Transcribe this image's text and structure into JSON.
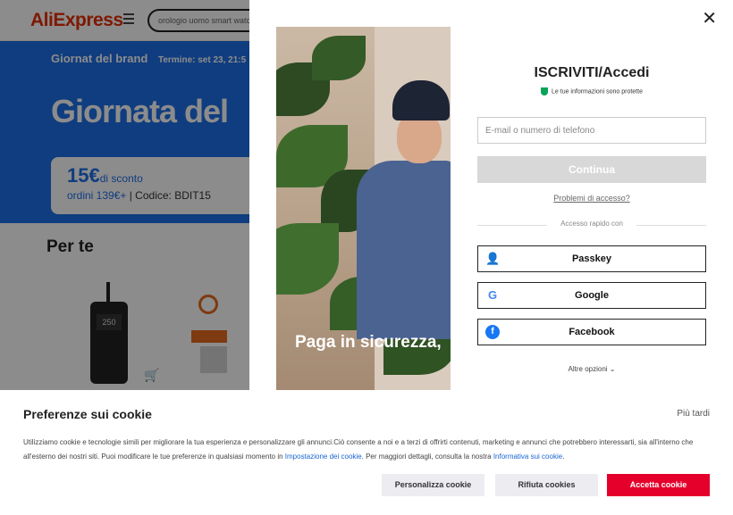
{
  "background": {
    "logo": "AliExpress",
    "search_value": "orologio uomo smart watch",
    "banner": {
      "brand_day": "Giornat del brand",
      "termine": "Termine: set 23, 21:5",
      "big_text": "Giornata del",
      "discount": "15€",
      "discount_suffix": "di sconto",
      "min_order": "ordini 139€+",
      "code": " | Codice: BDIT15"
    },
    "section_title": "Per te",
    "product_screen": "250"
  },
  "modal": {
    "title": "ISCRIVITI/Accedi",
    "secure_text": "Le tue informazioni sono protette",
    "email_placeholder": "E-mail o numero di telefono",
    "continue_label": "Continua",
    "access_problems": "Problemi di accesso?",
    "quick_access": "Accesso rapido con",
    "passkey": "Passkey",
    "google": "Google",
    "facebook": "Facebook",
    "more_options": "Altre opzioni",
    "photo_text": "Paga in sicurezza,"
  },
  "cookie": {
    "title": "Preferenze sui cookie",
    "later": "Più tardi",
    "text_1": "Utilizziamo cookie e tecnologie simili per migliorare la tua esperienza e personalizzare gli annunci.Ciò consente a noi e a terzi di offrirti contenuti, marketing e annunci che potrebbero interessarti, sia all'interno che all'esterno dei nostri siti. Puoi modificare le tue preferenze in qualsiasi momento in ",
    "link_1": "Impostazione dei cookie",
    "text_2": ". Per maggiori dettagli, consulta la nostra ",
    "link_2": "Informativa sui cookie",
    "text_3": ".",
    "customize": "Personalizza cookie",
    "reject": "Rifiuta cookies",
    "accept": "Accetta cookie"
  }
}
